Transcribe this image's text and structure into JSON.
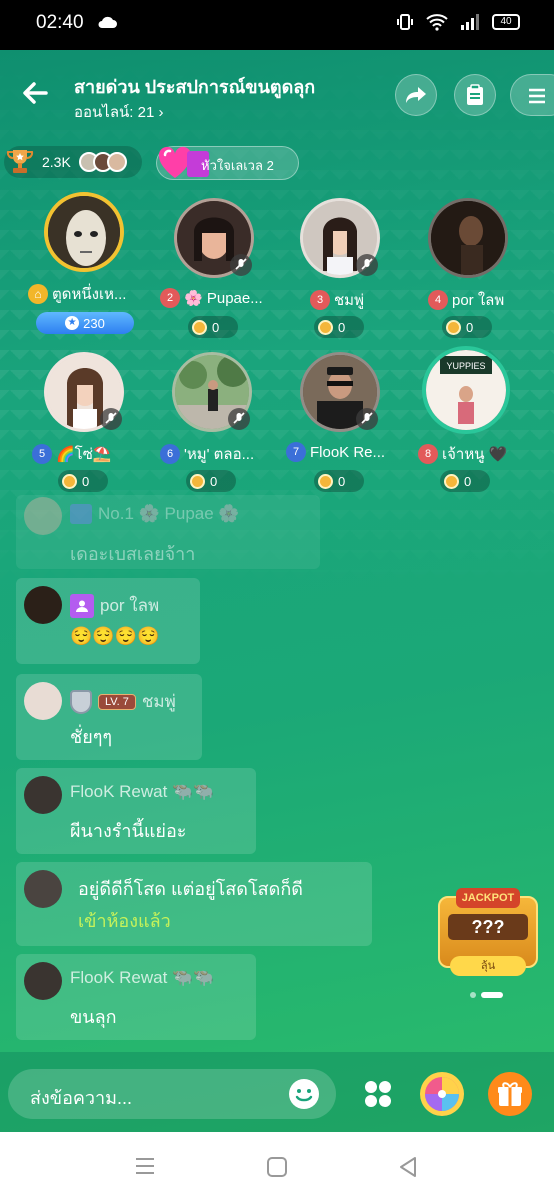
{
  "status_bar": {
    "time": "02:40",
    "battery": "40"
  },
  "header": {
    "title": "สายด่วน ประสปการณ์ขนตูดลุก",
    "online_label": "ออนไลน์: 21",
    "rank_score": "2.3K",
    "heart_level_label": "หัวใจเลเวล 2"
  },
  "seats": [
    {
      "name": "ตูดหนึ่งเห...",
      "badge": "230"
    },
    {
      "num": "2",
      "name": "🌸 Pupae...",
      "score": "0"
    },
    {
      "num": "3",
      "name": "ชมพู่",
      "score": "0"
    },
    {
      "num": "4",
      "name": "por ใลพ",
      "score": "0"
    },
    {
      "num": "5",
      "name": "🌈โซ่⛱️",
      "score": "0"
    },
    {
      "num": "6",
      "name": "'หมู' ตลอ...",
      "score": "0"
    },
    {
      "num": "7",
      "name": "FlooK Re...",
      "score": "0"
    },
    {
      "num": "8",
      "name": "เจ้าหนู 🖤",
      "score": "0"
    }
  ],
  "chat": [
    {
      "name": "No.1 🌸 Pupae 🌸",
      "text": "เดอะเบสเลยจ้าา"
    },
    {
      "name": "por ใลพ",
      "text": "😌😌😌😌"
    },
    {
      "level": "LV. 7",
      "name": "ชมพู่",
      "text": "ชั่ยๆๆ"
    },
    {
      "name": "FlooK Rewat 🐃🐃",
      "text": "ผีนางรำนี้แย่อะ"
    },
    {
      "text": "อยู่ดีดีก็โสด แต่อยู่โสดโสดก็ดี",
      "subtext": "เข้าห้องแล้ว"
    },
    {
      "name": "FlooK Rewat 🐃🐃",
      "text": "ขนลุก"
    }
  ],
  "jackpot": {
    "title": "JACKPOT",
    "value": "???",
    "button": "ลุ้น"
  },
  "input": {
    "placeholder": "ส่งข้อความ..."
  },
  "colors": {
    "accent": "#1ba877",
    "gold": "#f4b63a",
    "green_text": "#c6f25a"
  }
}
